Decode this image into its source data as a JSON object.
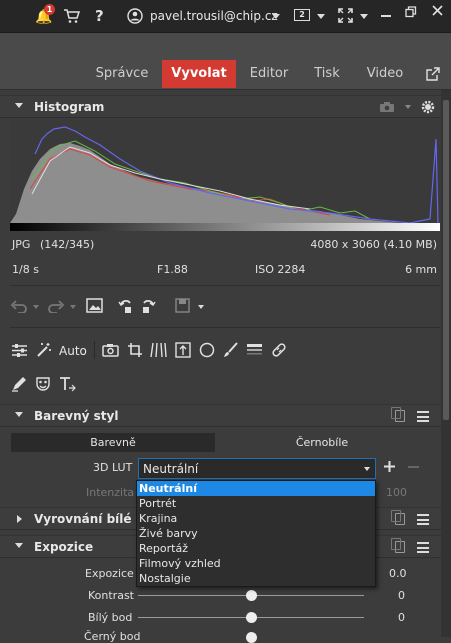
{
  "topbar": {
    "notification_count": "1",
    "help": "?",
    "user_email": "pavel.trousil@chip.cz",
    "monitor_label": "2"
  },
  "modes": [
    {
      "label": "Správce",
      "active": false
    },
    {
      "label": "Vyvolat",
      "active": true
    },
    {
      "label": "Editor",
      "active": false
    },
    {
      "label": "Tisk",
      "active": false
    },
    {
      "label": "Video",
      "active": false
    }
  ],
  "histogram": {
    "title": "Histogram",
    "format": "JPG",
    "count": "(142/345)",
    "resolution": "4080 x 3060 (4.10 MB)",
    "exposure_time": "1/8 s",
    "aperture": "F1.88",
    "iso": "ISO 2284",
    "focal": "6 mm"
  },
  "tools": {
    "auto_label": "Auto"
  },
  "color_style": {
    "title": "Barevný styl",
    "tab_color": "Barevně",
    "tab_bw": "Černobíle",
    "lut_label": "3D LUT",
    "lut_value": "Neutrální",
    "intensity_label": "Intenzita",
    "intensity_value": "100",
    "dropdown_options": [
      "Neutrální",
      "Portrét",
      "Krajina",
      "Živé barvy",
      "Reportáž",
      "Filmový vzhled",
      "Nostalgie"
    ]
  },
  "white_balance": {
    "title": "Vyrovnání bílé"
  },
  "exposure": {
    "title": "Expozice",
    "rows": [
      {
        "label": "Expozice",
        "value": "0.0",
        "position": 0.5
      },
      {
        "label": "Kontrast",
        "value": "0",
        "position": 0.5
      },
      {
        "label": "Bílý bod",
        "value": "0",
        "position": 0.5
      },
      {
        "label": "Černý bod",
        "value": "0",
        "position": 0.5
      }
    ]
  },
  "colors": {
    "accent": "#d23a32",
    "selection": "#1e88e5"
  }
}
